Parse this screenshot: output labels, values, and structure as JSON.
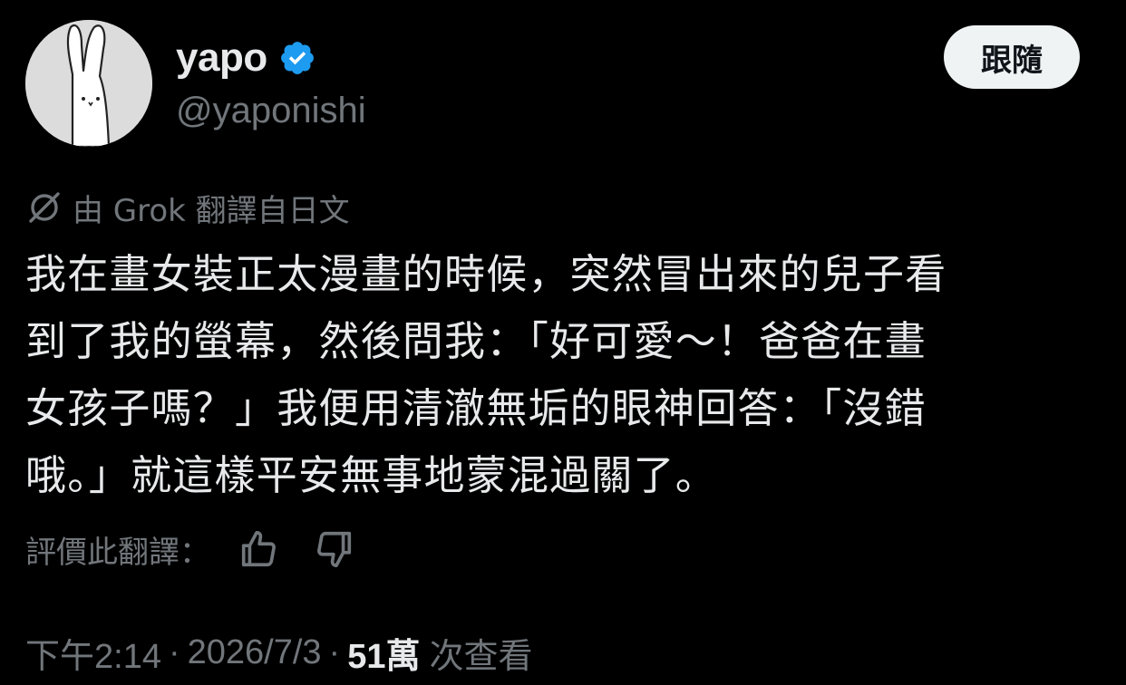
{
  "author": {
    "display_name": "yapo",
    "handle": "@yaponishi",
    "verified": true
  },
  "follow_button": {
    "label": "跟隨"
  },
  "translation_note": "由 Grok 翻譯自日文",
  "tweet_lines": [
    "我在畫女裝正太漫畫的時候，突然冒出來的兒子看",
    "到了我的螢幕，然後問我：「好可愛～！爸爸在畫",
    "女孩子嗎？」我便用清澈無垢的眼神回答：「沒錯",
    "哦。」就這樣平安無事地蒙混過關了。"
  ],
  "rate_translation": {
    "label": "評價此翻譯："
  },
  "meta": {
    "time": "下午2:14",
    "date": "2026/7/3",
    "views_count": "51萬",
    "views_label": "次查看",
    "separator": "·"
  },
  "colors": {
    "background": "#000000",
    "primary_text": "#e7e9ea",
    "secondary_text": "#71767b",
    "verified_blue": "#1d9bf0",
    "button_bg": "#eff3f4"
  }
}
